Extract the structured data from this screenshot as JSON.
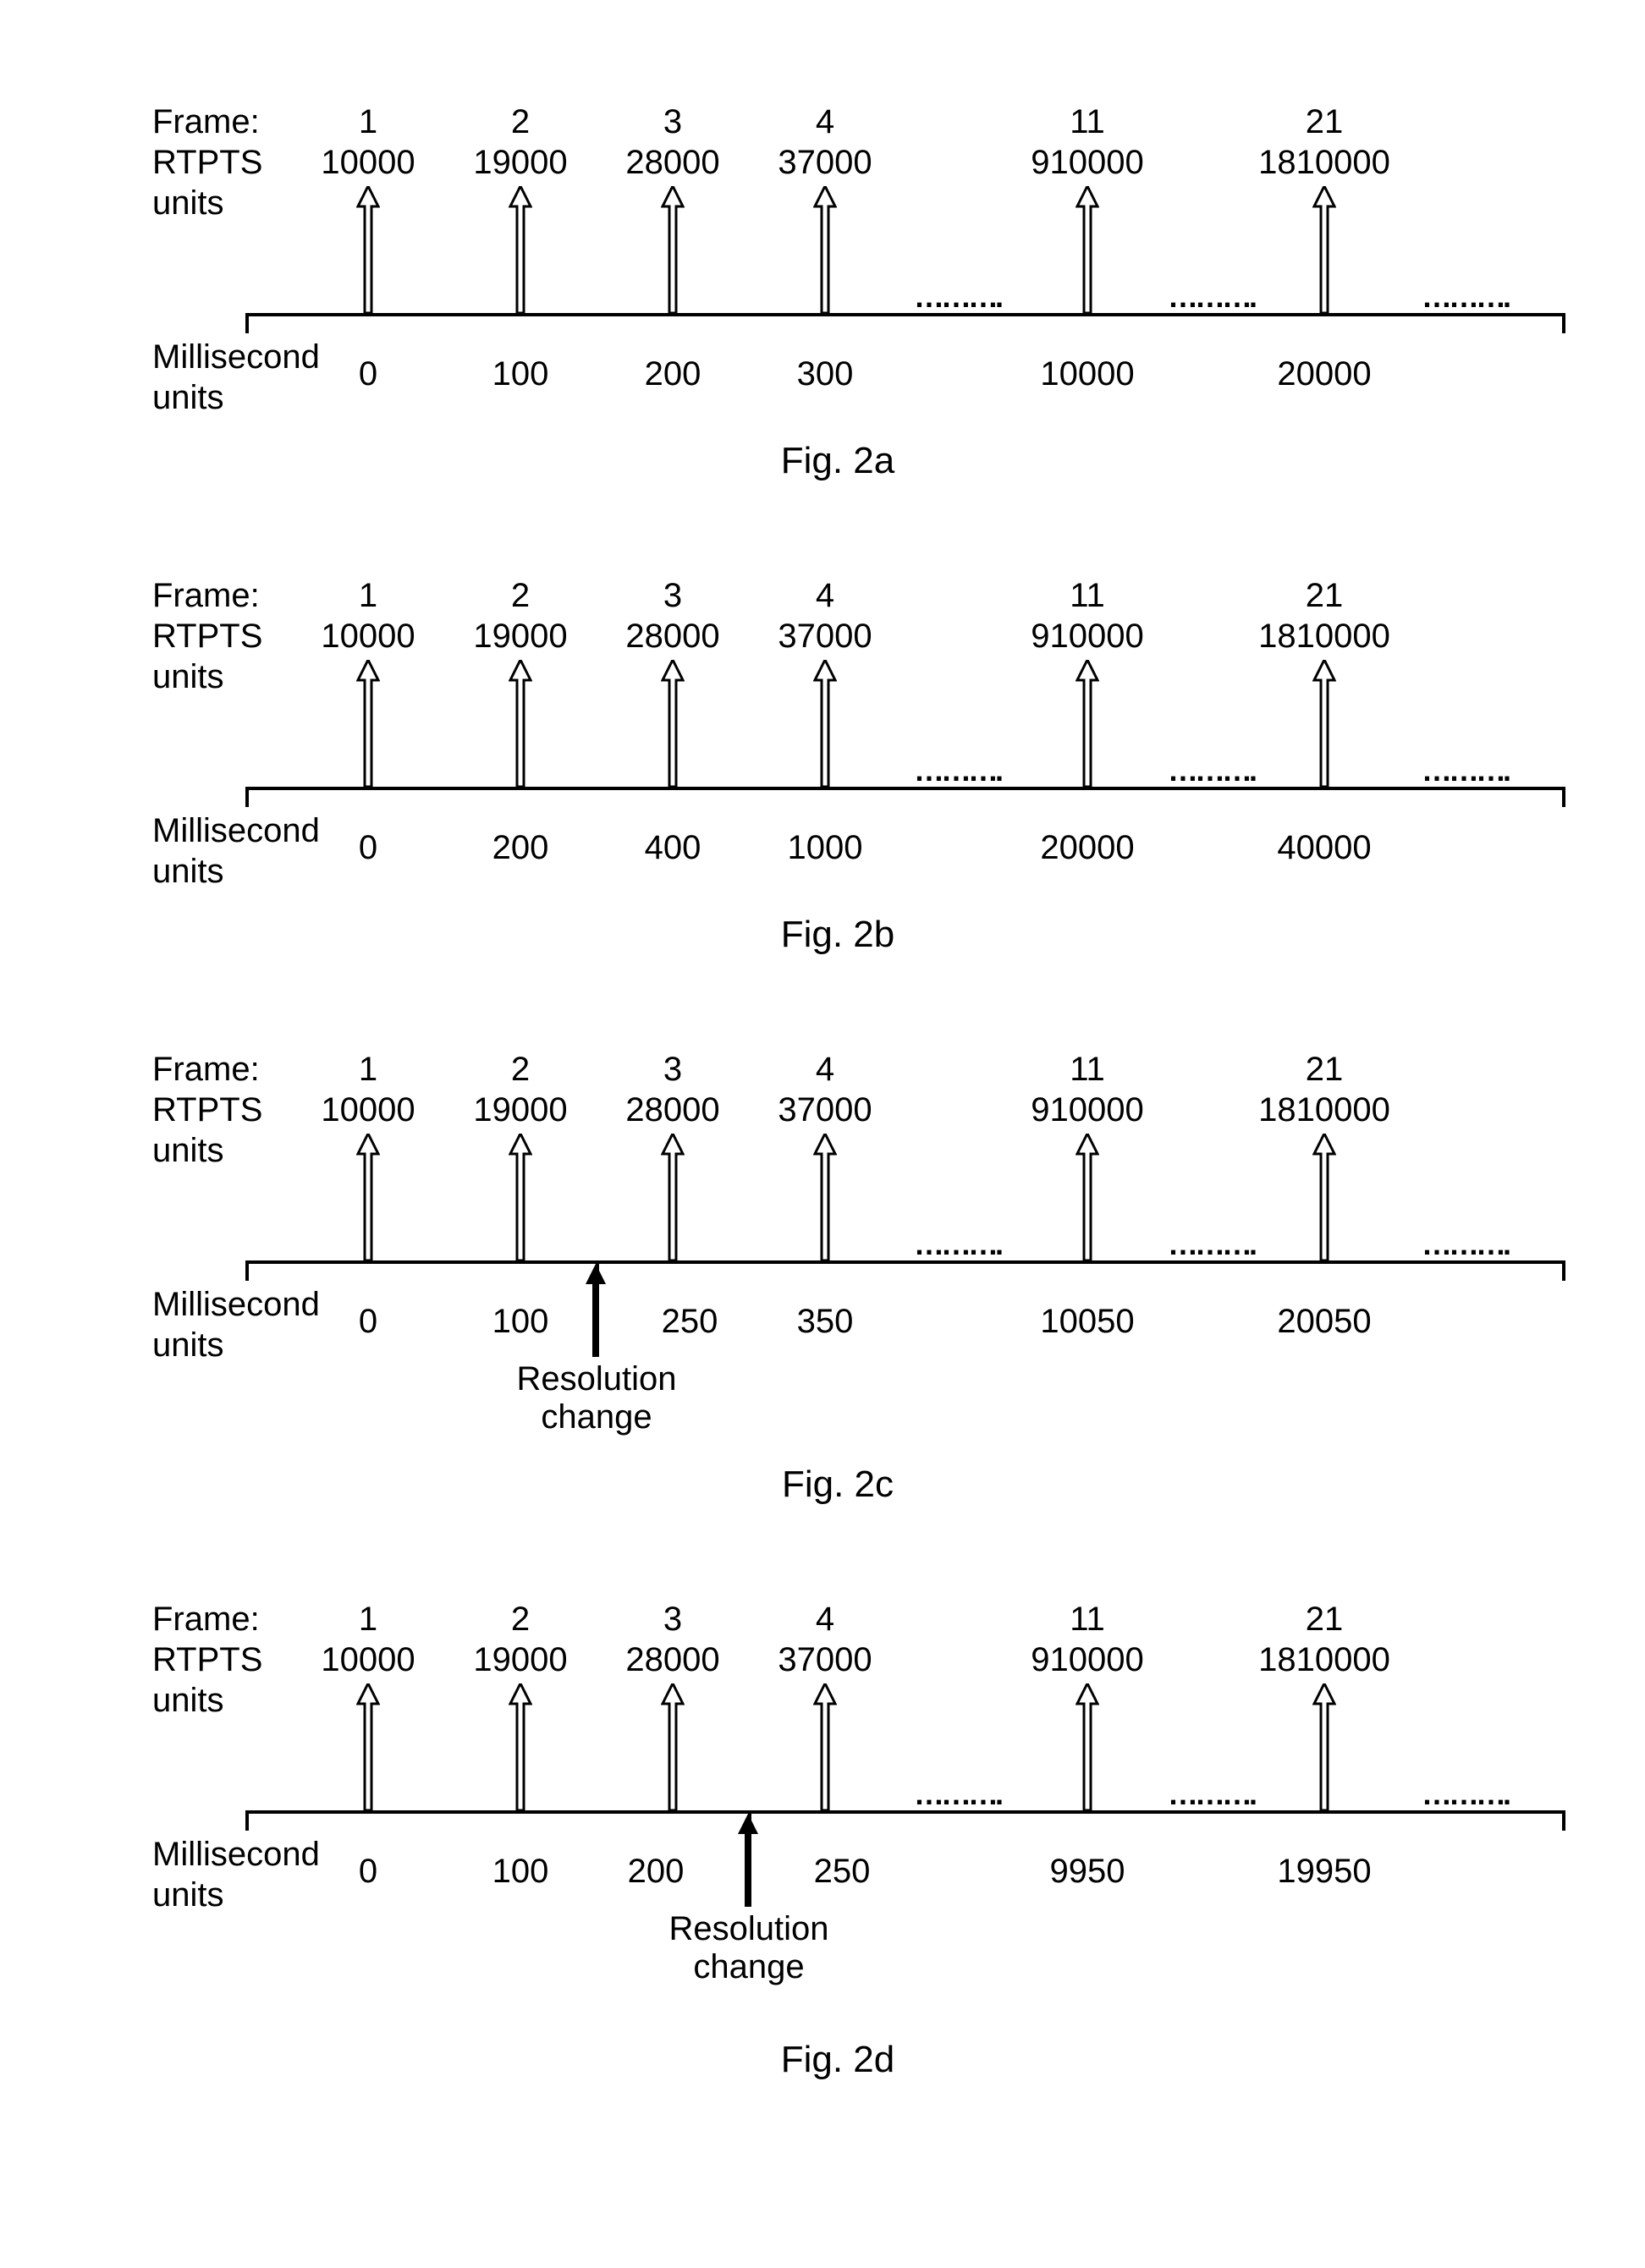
{
  "labels": {
    "frame": "Frame:",
    "rtpts1": "RTPTS",
    "rtpts2": "units",
    "ms1": "Millisecond",
    "ms2": "units",
    "dots": "……….",
    "resolution1": "Resolution",
    "resolution2": "change"
  },
  "figs": {
    "a": {
      "caption": "Fig. 2a",
      "cols": [
        {
          "frame": "1",
          "rtpts": "10000",
          "ms": "0"
        },
        {
          "frame": "2",
          "rtpts": "19000",
          "ms": "100"
        },
        {
          "frame": "3",
          "rtpts": "28000",
          "ms": "200"
        },
        {
          "frame": "4",
          "rtpts": "37000",
          "ms": "300"
        },
        {
          "frame": "11",
          "rtpts": "910000",
          "ms": "10000"
        },
        {
          "frame": "21",
          "rtpts": "1810000",
          "ms": "20000"
        }
      ]
    },
    "b": {
      "caption": "Fig. 2b",
      "cols": [
        {
          "frame": "1",
          "rtpts": "10000",
          "ms": "0"
        },
        {
          "frame": "2",
          "rtpts": "19000",
          "ms": "200"
        },
        {
          "frame": "3",
          "rtpts": "28000",
          "ms": "400"
        },
        {
          "frame": "4",
          "rtpts": "37000",
          "ms": "1000"
        },
        {
          "frame": "11",
          "rtpts": "910000",
          "ms": "20000"
        },
        {
          "frame": "21",
          "rtpts": "1810000",
          "ms": "40000"
        }
      ]
    },
    "c": {
      "caption": "Fig. 2c",
      "cols": [
        {
          "frame": "1",
          "rtpts": "10000",
          "ms": "0"
        },
        {
          "frame": "2",
          "rtpts": "19000",
          "ms": "100"
        },
        {
          "frame": "3",
          "rtpts": "28000",
          "ms": "250"
        },
        {
          "frame": "4",
          "rtpts": "37000",
          "ms": "350"
        },
        {
          "frame": "11",
          "rtpts": "910000",
          "ms": "10050"
        },
        {
          "frame": "21",
          "rtpts": "1810000",
          "ms": "20050"
        }
      ]
    },
    "d": {
      "caption": "Fig. 2d",
      "cols": [
        {
          "frame": "1",
          "rtpts": "10000",
          "ms": "0"
        },
        {
          "frame": "2",
          "rtpts": "19000",
          "ms": "100"
        },
        {
          "frame": "3",
          "rtpts": "28000",
          "ms": "200"
        },
        {
          "frame": "4",
          "rtpts": "37000",
          "ms": "250"
        },
        {
          "frame": "11",
          "rtpts": "910000",
          "ms": "9950"
        },
        {
          "frame": "21",
          "rtpts": "1810000",
          "ms": "19950"
        }
      ]
    }
  },
  "chart_data": [
    {
      "type": "table",
      "title": "Fig. 2a",
      "columns": [
        "Frame",
        "RTPTS units",
        "Millisecond units"
      ],
      "rows": [
        [
          1,
          10000,
          0
        ],
        [
          2,
          19000,
          100
        ],
        [
          3,
          28000,
          200
        ],
        [
          4,
          37000,
          300
        ],
        [
          11,
          910000,
          10000
        ],
        [
          21,
          1810000,
          20000
        ]
      ]
    },
    {
      "type": "table",
      "title": "Fig. 2b",
      "columns": [
        "Frame",
        "RTPTS units",
        "Millisecond units"
      ],
      "rows": [
        [
          1,
          10000,
          0
        ],
        [
          2,
          19000,
          200
        ],
        [
          3,
          28000,
          400
        ],
        [
          4,
          37000,
          1000
        ],
        [
          11,
          910000,
          20000
        ],
        [
          21,
          1810000,
          40000
        ]
      ]
    },
    {
      "type": "table",
      "title": "Fig. 2c",
      "columns": [
        "Frame",
        "RTPTS units",
        "Millisecond units"
      ],
      "rows": [
        [
          1,
          10000,
          0
        ],
        [
          2,
          19000,
          100
        ],
        [
          3,
          28000,
          250
        ],
        [
          4,
          37000,
          350
        ],
        [
          11,
          910000,
          10050
        ],
        [
          21,
          1810000,
          20050
        ]
      ],
      "annotations": [
        {
          "text": "Resolution change",
          "between_frames": [
            2,
            3
          ]
        }
      ]
    },
    {
      "type": "table",
      "title": "Fig. 2d",
      "columns": [
        "Frame",
        "RTPTS units",
        "Millisecond units"
      ],
      "rows": [
        [
          1,
          10000,
          0
        ],
        [
          2,
          19000,
          100
        ],
        [
          3,
          28000,
          200
        ],
        [
          4,
          37000,
          250
        ],
        [
          11,
          910000,
          9950
        ],
        [
          21,
          1810000,
          19950
        ]
      ],
      "annotations": [
        {
          "text": "Resolution change",
          "between_frames": [
            3,
            4
          ]
        }
      ]
    }
  ]
}
